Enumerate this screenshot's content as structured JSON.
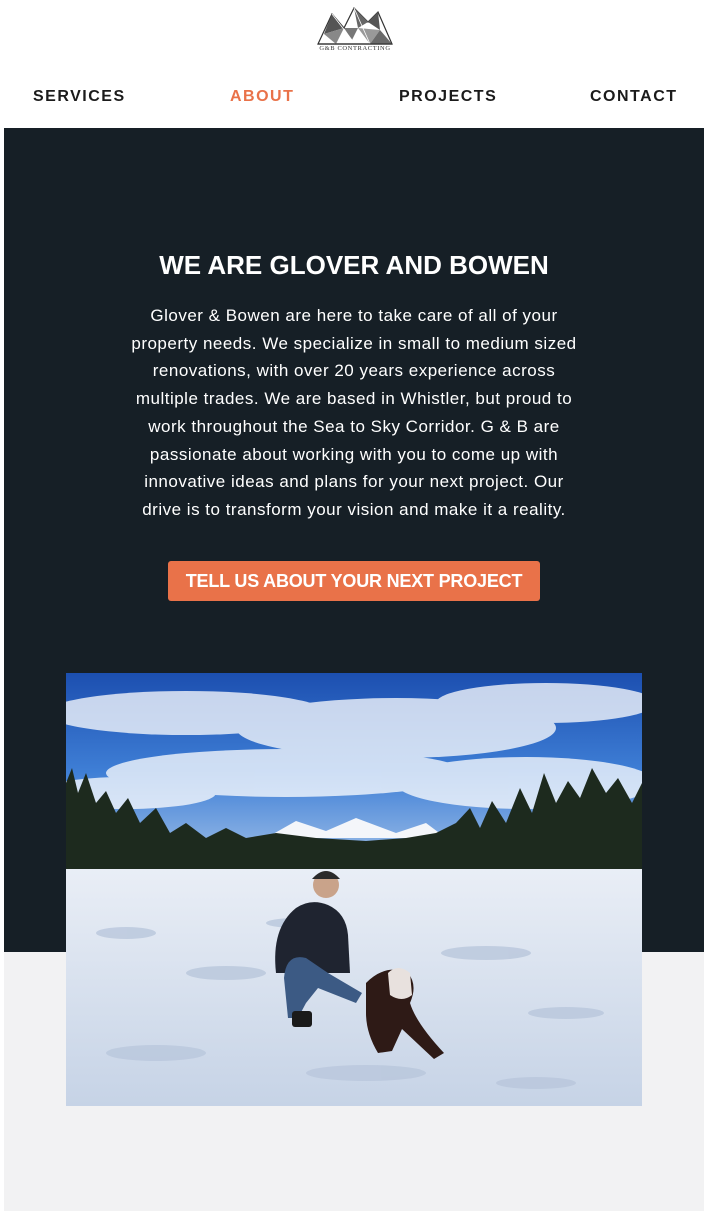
{
  "header": {
    "logo_text": "G&B CONTRACTING"
  },
  "nav": {
    "items": [
      {
        "label": "SERVICES"
      },
      {
        "label": "ABOUT"
      },
      {
        "label": "PROJECTS"
      },
      {
        "label": "CONTACT"
      }
    ],
    "active": "ABOUT"
  },
  "hero": {
    "title": "WE ARE GLOVER AND BOWEN",
    "body": "Glover & Bowen are here to take care of all of your property needs. We specialize in small to medium sized renovations, with over 20 years experience across multiple trades. We are based in Whistler, but proud to work throughout the Sea to Sky Corridor. G & B are passionate about working with you to come up with innovative ideas and plans for your next project. Our drive is to transform your vision and make it a reality.",
    "cta_label": "TELL US ABOUT YOUR NEXT PROJECT"
  },
  "colors": {
    "accent": "#e97249",
    "hero_bg": "#161f26",
    "light_bg": "#f2f2f3",
    "nav_text": "#1b1b1b"
  }
}
